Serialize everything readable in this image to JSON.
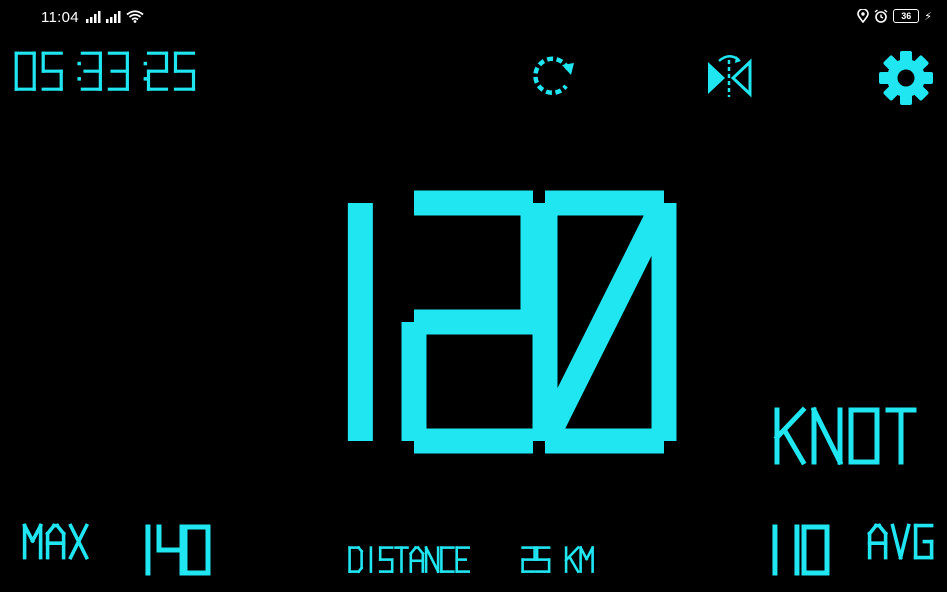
{
  "status_bar": {
    "time": "11:04",
    "battery": "36",
    "icons": [
      "signal-icon",
      "signal-icon",
      "wifi-icon",
      "location-icon",
      "alarm-icon",
      "battery-icon",
      "charging-icon"
    ]
  },
  "header": {
    "clock": "05:33:25",
    "buttons": [
      "reset-icon",
      "mirror-icon",
      "settings-icon"
    ]
  },
  "speedometer": {
    "speed": "120",
    "unit": "KNOT"
  },
  "footer": {
    "max_label": "MAX",
    "max_value": "140",
    "distance_label": "DISTANCE",
    "distance_value": "25 KM",
    "avg_value": "110",
    "avg_label": "AVG"
  },
  "colors": {
    "accent": "#20e6f2",
    "background": "#000000",
    "status_text": "#ffffff"
  }
}
